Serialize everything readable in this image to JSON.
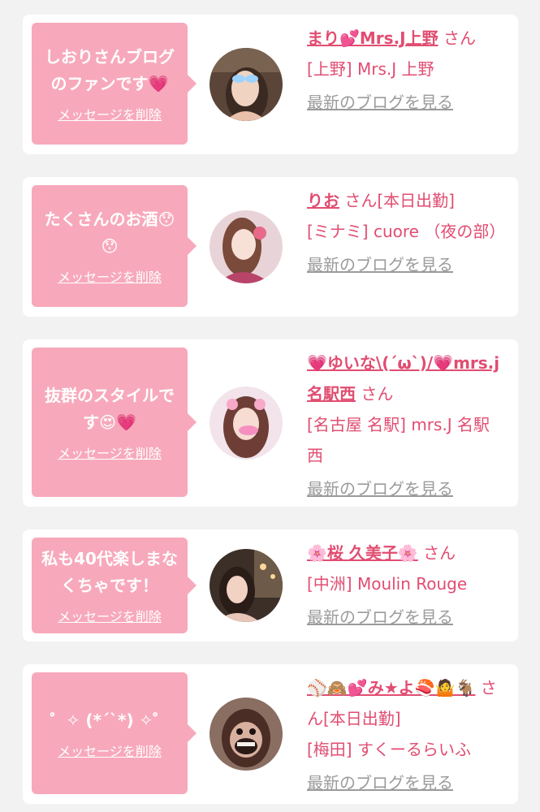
{
  "colors": {
    "accent": "#e14d71",
    "bubble": "#f7a9bb",
    "muted": "#9b9b9b",
    "background": "#f2f2f2"
  },
  "fans": [
    {
      "message": "しおりさんブログのファンです💗",
      "delete_label": "メッセージを削除",
      "nickname": "まり💕Mrs.J上野",
      "suffix": "さん",
      "shop": "[上野] Mrs.J 上野",
      "blog_link": "最新のブログを見る"
    },
    {
      "message": "たくさんのお酒😯😯",
      "delete_label": "メッセージを削除",
      "nickname": "りお",
      "suffix": "さん[本日出勤]",
      "shop": "[ミナミ] cuore （夜の部）",
      "blog_link": "最新のブログを見る"
    },
    {
      "message": "抜群のスタイルです😍💗",
      "delete_label": "メッセージを削除",
      "nickname": "💗ゆいな\\(´ω`)/💗mrs.j名駅西",
      "suffix": "さん",
      "shop": "[名古屋 名駅] mrs.J 名駅西",
      "blog_link": "最新のブログを見る"
    },
    {
      "message": "私も40代楽しまなくちゃです！",
      "delete_label": "メッセージを削除",
      "nickname": "🌸桜 久美子🌸",
      "suffix": "さん",
      "shop": "[中洲] Moulin Rouge",
      "blog_link": "最新のブログを見る"
    },
    {
      "message": "゜✧ (*´`*) ✧゜",
      "delete_label": "メッセージを削除",
      "nickname": "⚾🙈💕み★よ🍣🤷🐐",
      "suffix": "さん[本日出勤]",
      "shop": "[梅田] すくーるらいふ",
      "blog_link": "最新のブログを見る"
    }
  ]
}
